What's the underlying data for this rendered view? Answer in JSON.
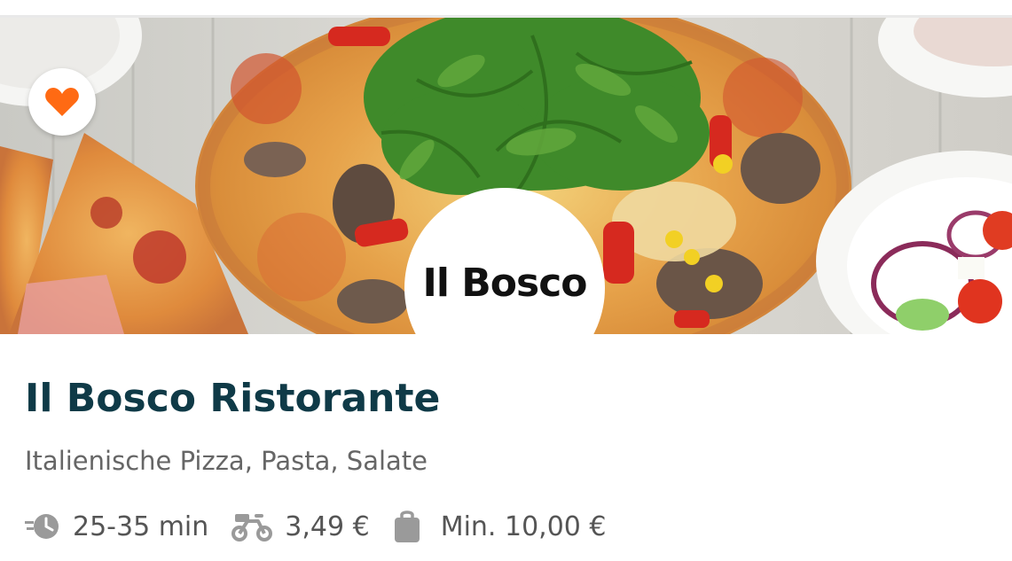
{
  "restaurant": {
    "logo_text": "Il Bosco",
    "name": "Il Bosco Ristorante",
    "cuisine": "Italienische Pizza, Pasta, Salate",
    "delivery_time": "25-35 min",
    "delivery_fee": "3,49 €",
    "min_order": "Min. 10,00 €"
  },
  "icons": {
    "favorite": "heart-icon",
    "delivery_time": "clock-icon",
    "delivery_fee": "scooter-icon",
    "min_order": "bag-icon"
  },
  "colors": {
    "accent": "#ff6a13",
    "title": "#0f3a47",
    "subtitle": "#666666",
    "meta_icon": "#9a9a9a"
  }
}
